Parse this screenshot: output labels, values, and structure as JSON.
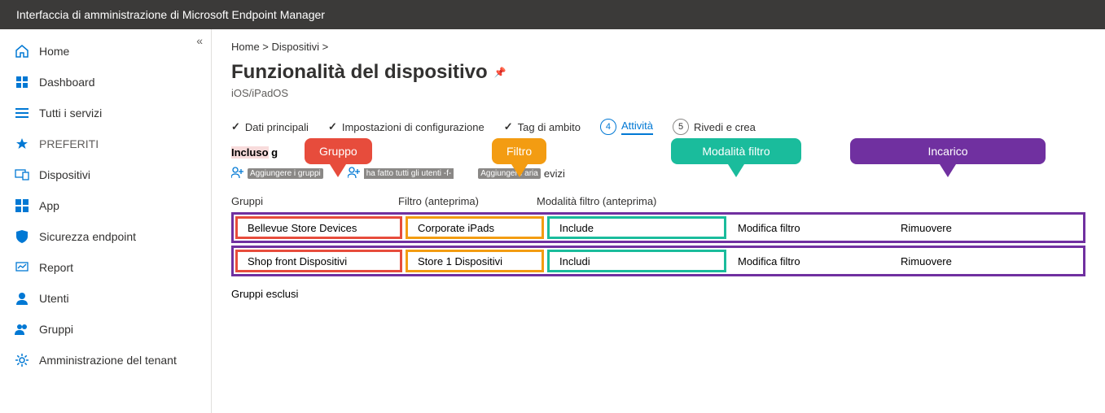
{
  "topbar": {
    "title": "Interfaccia di amministrazione di Microsoft Endpoint Manager"
  },
  "sidebar": {
    "items": [
      {
        "label": "Home"
      },
      {
        "label": "Dashboard"
      },
      {
        "label": "Tutti i servizi"
      },
      {
        "label": "PREFERITI"
      },
      {
        "label": "Dispositivi"
      },
      {
        "label": "App"
      },
      {
        "label": "Sicurezza endpoint"
      },
      {
        "label": "Report"
      },
      {
        "label": "Utenti"
      },
      {
        "label": "Gruppi"
      },
      {
        "label": "Amministrazione del tenant"
      }
    ]
  },
  "breadcrumb": {
    "part1": "Home >",
    "part2": "Dispositivi >"
  },
  "page": {
    "title": "Funzionalità del dispositivo",
    "subtitle": "iOS/iPadOS"
  },
  "steps": [
    {
      "label": "Dati principali",
      "done": true
    },
    {
      "label": "Impostazioni di configurazione",
      "done": true
    },
    {
      "label": "Tag di ambito",
      "done": true
    },
    {
      "label": "Attività",
      "num": "4",
      "active": true
    },
    {
      "label": "Rivedi e crea",
      "num": "5"
    }
  ],
  "section": {
    "included_prefix": "Incluso",
    "included_rest": " g",
    "excluded": "Gruppi esclusi"
  },
  "actions": {
    "add_groups_tag": "Aggiungere i gruppi",
    "add_all_users": "ha fatto tutti gli utenti -f-",
    "add_all_devices_tag": "Aggiungere aria",
    "add_all_devices_suffix": "evizi"
  },
  "table": {
    "headers": {
      "group": "Gruppi",
      "filter": "Filtro (anteprima)",
      "mode": "Modalità filtro (anteprima)",
      "edit": "",
      "remove": ""
    },
    "rows": [
      {
        "group": "Bellevue Store Devices",
        "filter": "Corporate iPads",
        "mode": "Include",
        "edit": "Modifica filtro",
        "remove": "Rimuovere"
      },
      {
        "group": "Shop front Dispositivi",
        "filter": "Store 1   Dispositivi",
        "mode": "Includi",
        "edit": "Modifica filtro",
        "remove": "Rimuovere"
      }
    ]
  },
  "callouts": {
    "group": "Gruppo",
    "filter": "Filtro",
    "mode": "Modalità filtro",
    "assignment": "Incarico"
  }
}
